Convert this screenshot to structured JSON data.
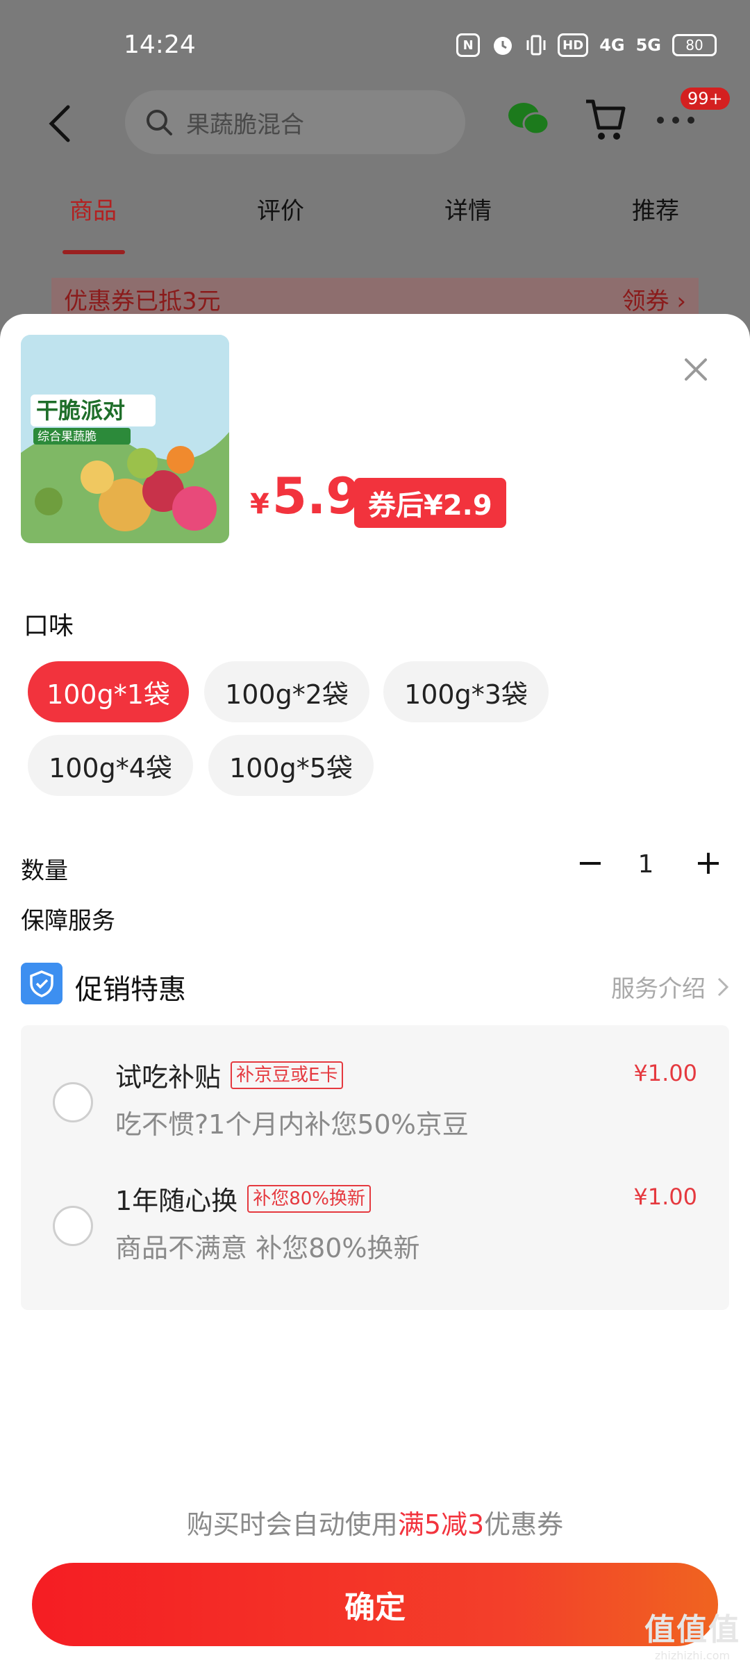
{
  "status_bar": {
    "time": "14:24",
    "icons": [
      "nfc-icon",
      "alarm-icon",
      "vibrate-icon",
      "hd-icon",
      "4g-signal-icon",
      "5g-signal-icon"
    ],
    "hd_label": "HD",
    "signal_4g": "4G",
    "signal_5g": "5G",
    "battery": "80"
  },
  "header": {
    "search_placeholder": "果蔬脆混合",
    "more_badge": "99+"
  },
  "tabs": [
    {
      "label": "商品",
      "active": true
    },
    {
      "label": "评价",
      "active": false
    },
    {
      "label": "详情",
      "active": false
    },
    {
      "label": "推荐",
      "active": false
    }
  ],
  "coupon_strip": {
    "text": "优惠券已抵3元",
    "action": "领券"
  },
  "product": {
    "image_alt": "干脆派对 综合果蔬脆",
    "image_title": "干脆派对",
    "image_subtitle": "综合果蔬脆",
    "currency": "¥",
    "price": "5.9",
    "after_coupon": "券后¥2.9"
  },
  "flavor": {
    "title": "口味",
    "options": [
      "100g*1袋",
      "100g*2袋",
      "100g*3袋",
      "100g*4袋",
      "100g*5袋"
    ],
    "selected_index": 0
  },
  "quantity": {
    "label": "数量",
    "minus": "−",
    "value": "1",
    "plus": "+"
  },
  "guarantee": {
    "title": "保障服务",
    "promo_title": "促销特惠",
    "service_intro": "服务介绍",
    "items": [
      {
        "name": "试吃补贴",
        "tag": "补京豆或E卡",
        "desc": "吃不惯?1个月内补您50%京豆",
        "price": "¥1.00"
      },
      {
        "name": "1年随心换",
        "tag": "补您80%换新",
        "desc": "商品不满意 补您80%换新",
        "price": "¥1.00"
      }
    ]
  },
  "auto_note": {
    "prefix": "购买时会自动使用",
    "highlight": "满5减3",
    "suffix": "优惠券"
  },
  "confirm_label": "确定",
  "watermark": {
    "logo": "值值值",
    "site": "zhizhizhi.com"
  },
  "colors": {
    "accent": "#f2333d",
    "tab_active": "#b32020",
    "shield_blue": "#3d8ff0"
  }
}
